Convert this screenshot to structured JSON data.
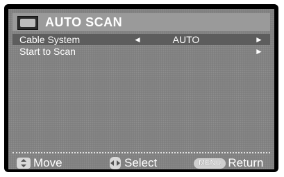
{
  "menu": {
    "title": "AUTO SCAN",
    "title_icon": "tv-icon"
  },
  "rows": [
    {
      "label": "Cable System",
      "value": "AUTO",
      "left_arrow": "◄",
      "right_arrow": "►",
      "selected": true
    },
    {
      "label": "Start to Scan",
      "right_arrow": "►",
      "selected": false
    }
  ],
  "footer": {
    "move_icon": "up-down-icon",
    "move_label": "Move",
    "select_icon": "left-right-icon",
    "select_label": "Select",
    "return_key": "MENU",
    "return_label": "Return"
  },
  "colors": {
    "screen_bg": "#7c7c7c",
    "title_bar": "#9a9a9a",
    "highlight": "#5d5d5d",
    "text": "#ffffff"
  }
}
